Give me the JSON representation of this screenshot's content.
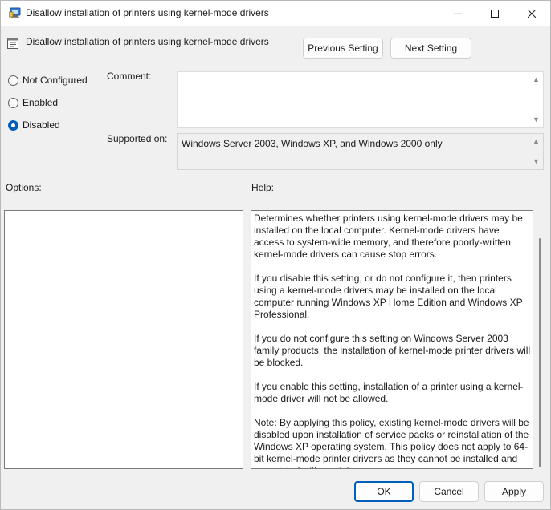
{
  "window": {
    "title": "Disallow installation of printers using kernel-mode drivers",
    "controls": [
      "minimize",
      "maximize",
      "close"
    ]
  },
  "header": {
    "policy_name": "Disallow installation of printers using kernel-mode drivers",
    "prev_label": "Previous Setting",
    "next_label": "Next Setting"
  },
  "state": {
    "options": [
      {
        "label": "Not Configured",
        "selected": false
      },
      {
        "label": "Enabled",
        "selected": false
      },
      {
        "label": "Disabled",
        "selected": true
      }
    ]
  },
  "comment": {
    "label": "Comment:",
    "value": ""
  },
  "supported": {
    "label": "Supported on:",
    "value": "Windows Server 2003, Windows XP, and Windows 2000 only"
  },
  "options_label": "Options:",
  "help_label": "Help:",
  "help": {
    "paragraphs": [
      "Determines whether printers using kernel-mode drivers may be installed on the local computer.  Kernel-mode drivers have access to system-wide memory, and therefore poorly-written kernel-mode drivers can cause stop errors.",
      "If you disable this setting, or do not configure it, then printers using a kernel-mode drivers may be installed on the local computer running Windows XP Home Edition and Windows XP Professional.",
      "If you do not configure this setting on Windows Server 2003 family products, the installation of kernel-mode printer drivers will be blocked.",
      "If you enable this setting, installation of a printer using a kernel-mode driver will not be allowed.",
      "Note: By applying this policy, existing kernel-mode drivers will be disabled upon installation of service packs or reinstallation of the Windows XP operating system. This policy does not apply to 64-bit kernel-mode printer drivers as they cannot be installed and associated with a print queue."
    ]
  },
  "buttons": {
    "ok": "OK",
    "cancel": "Cancel",
    "apply": "Apply"
  },
  "colors": {
    "accent": "#005fb8",
    "window_bg": "#f0f0f0",
    "titlebar_bg": "#ffffff"
  }
}
